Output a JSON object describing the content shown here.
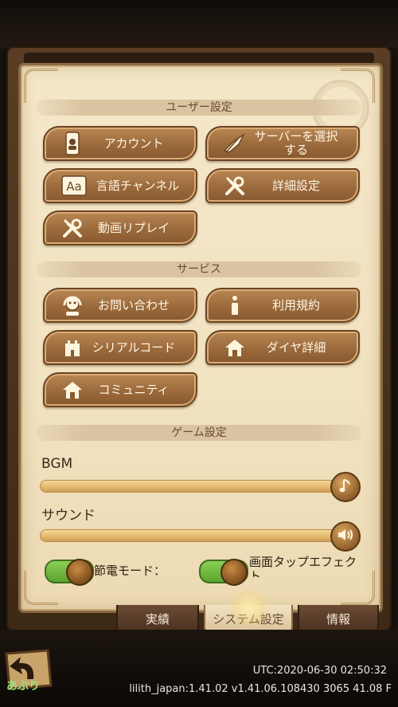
{
  "sections": {
    "user": "ユーザー設定",
    "service": "サービス",
    "game": "ゲーム設定"
  },
  "user_buttons": {
    "account": "アカウント",
    "server": "サーバーを選択する",
    "language": "言語チャンネル",
    "details": "詳細設定",
    "replay": "動画リプレイ"
  },
  "service_buttons": {
    "contact": "お問い合わせ",
    "terms": "利用規約",
    "serial": "シリアルコード",
    "diamond": "ダイヤ詳細",
    "community": "コミュニティ"
  },
  "game_settings": {
    "bgm_label": "BGM",
    "bgm_level": 1.0,
    "sound_label": "サウンド",
    "sound_level": 1.0,
    "power_save_label": "節電モード：",
    "power_save_on": true,
    "tap_effect_label": "画面タップエフェクト",
    "tap_effect_on": true
  },
  "tabs": {
    "achievements": "実績",
    "system": "システム設定",
    "info": "情報"
  },
  "footer": {
    "back_label": "あぶり",
    "utc": "UTC:2020-06-30 02:50:32",
    "version": "lilith_japan:1.41.02  v1.41.06.108430 3065 41.08 F"
  },
  "colors": {
    "panel_bg": "#f2e4c3",
    "button_brown": "#9b6a3c",
    "toggle_green": "#6fb83e"
  }
}
